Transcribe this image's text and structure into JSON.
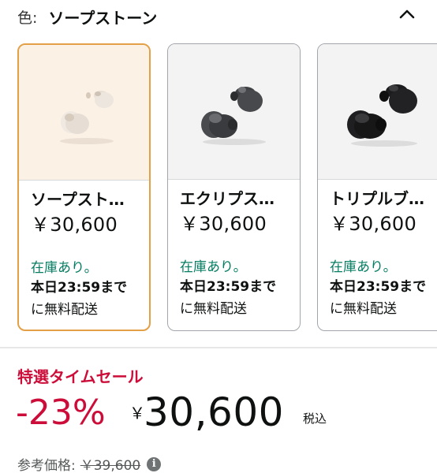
{
  "color": {
    "label": "色:",
    "value": "ソープストーン"
  },
  "icons": {
    "collapse": "chevron-up-icon",
    "info": "info-icon"
  },
  "variants": [
    {
      "title": "ソープスト…",
      "price": "￥30,600",
      "stock": "在庫あり。",
      "delivery_bold": "本日23:59まで",
      "delivery_rest": "に無料配送",
      "selected": true
    },
    {
      "title": "エクリプス…",
      "price": "￥30,600",
      "stock": "在庫あり。",
      "delivery_bold": "本日23:59まで",
      "delivery_rest": "に無料配送",
      "selected": false
    },
    {
      "title": "トリプルブ…",
      "price": "￥30,600",
      "stock": "在庫あり。",
      "delivery_bold": "本日23:59まで",
      "delivery_rest": "に無料配送",
      "selected": false
    }
  ],
  "deal": {
    "badge": "特選タイムセール",
    "discount": "-23%",
    "currency": "￥",
    "price": "30,600",
    "tax_label": "税込",
    "reference_label": "参考価格:",
    "reference_price": "￥39,600"
  },
  "colors": {
    "deal_red": "#cc0c39",
    "in_stock_green": "#067d62",
    "selected_border": "#e3a046"
  }
}
